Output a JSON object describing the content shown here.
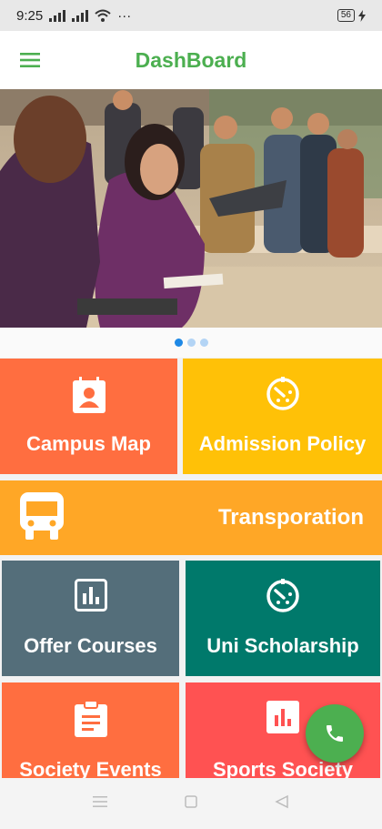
{
  "status_bar": {
    "time": "9:25",
    "battery": "56",
    "more": "···"
  },
  "app_bar": {
    "title": "DashBoard"
  },
  "carousel": {
    "slides": 3,
    "active_index": 0
  },
  "tiles": [
    {
      "label": "Campus Map",
      "icon": "contact-card-icon",
      "color": "#ff6e40"
    },
    {
      "label": "Admission Policy",
      "icon": "timer-icon",
      "color": "#ffc107"
    },
    {
      "label": "Transporation",
      "icon": "bus-icon",
      "color": "#ffa726"
    },
    {
      "label": "Offer Courses",
      "icon": "bar-chart-icon",
      "color": "#546e7a"
    },
    {
      "label": "Uni Scholarship",
      "icon": "timer-icon",
      "color": "#00796b"
    },
    {
      "label": "Society Events",
      "icon": "clipboard-icon",
      "color": "#ff6e40"
    },
    {
      "label": "Sports Society",
      "icon": "bar-chart-icon",
      "color": "#ff5252"
    }
  ],
  "fab": {
    "icon": "phone-icon",
    "color": "#4caf50"
  },
  "nav_bar": {
    "icons": [
      "menu-icon",
      "home-square-icon",
      "back-triangle-icon"
    ]
  }
}
